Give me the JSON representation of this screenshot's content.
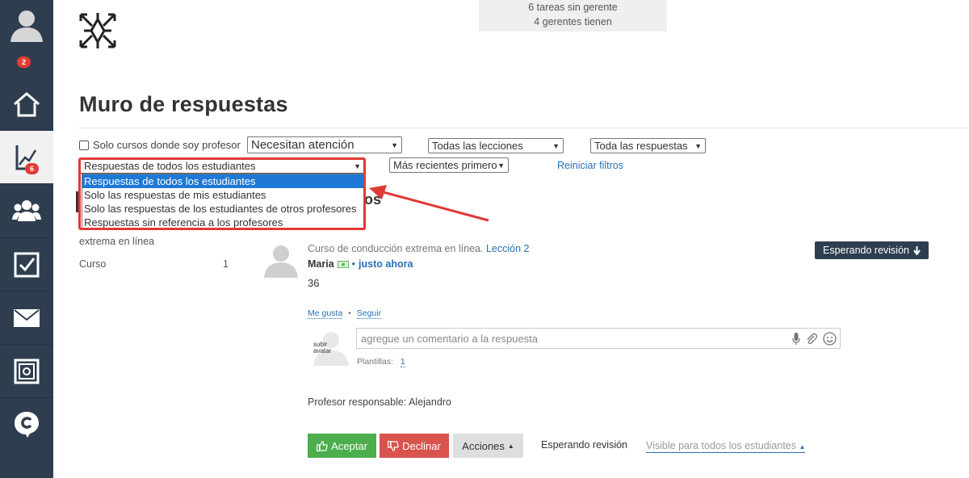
{
  "sidebar": {
    "badge_top": "2",
    "badge_active": "6",
    "items": [
      {
        "name": "profile",
        "icon": "user-icon"
      },
      {
        "name": "home",
        "icon": "home-icon"
      },
      {
        "name": "stats",
        "icon": "chart-icon"
      },
      {
        "name": "users",
        "icon": "users-group-icon"
      },
      {
        "name": "tasks",
        "icon": "checkbox-icon"
      },
      {
        "name": "messages",
        "icon": "mail-icon"
      },
      {
        "name": "vault",
        "icon": "safe-icon"
      },
      {
        "name": "chat",
        "icon": "chat-c-icon"
      }
    ]
  },
  "stats": {
    "line1": "6 tareas sin gerente",
    "line2": "4 gerentes tienen"
  },
  "page": {
    "title": "Muro de respuestas"
  },
  "filters": {
    "only_my_courses_label": "Solo cursos donde soy profesor",
    "attention_value": "Necesitan atención",
    "lessons_value": "Todas las lecciones",
    "responses_value": "Toda las respuestas",
    "students_value": "Respuestas de todos los estudiantes",
    "order_value": "Más recientes primero",
    "reset_label": "Reiniciar filtros",
    "student_options": [
      "Respuestas de todos los estudiantes",
      "Solo las respuestas de mis estudiantes",
      "Solo las respuestas de los estudiantes de otros profesores",
      "Respuestas sin referencia a los profesores"
    ]
  },
  "left_panel": {
    "heading_tail": "os",
    "course_line": "extrema en línea",
    "course_label": "Curso",
    "course_count": "1"
  },
  "post": {
    "course": "Curso de conducción extrema en línea.",
    "lesson_link": "Lección 2",
    "author": "Maria",
    "time_link": "justo ahora",
    "body": "36",
    "status_button": "Esperando revisión",
    "like": "Me gusta",
    "follow": "Seguir",
    "upload_avatar": "subir avatar",
    "comment_placeholder": "agregue un comentario a la respuesta",
    "templates_label": "Plantillas:",
    "templates_count": "1",
    "teacher_line": "Profesor responsable: Alejandro",
    "accept": "Aceptar",
    "decline": "Declinar",
    "actions": "Acciones",
    "status_text": "Esperando revisión",
    "visibility": "Visible para todos los estudiantes"
  },
  "colors": {
    "sidebar_bg": "#2e3e4f",
    "badge": "#e23c37",
    "highlight": "#e03a35",
    "accept": "#4cae4c",
    "decline": "#d9534f",
    "link": "#2a6fb3"
  }
}
